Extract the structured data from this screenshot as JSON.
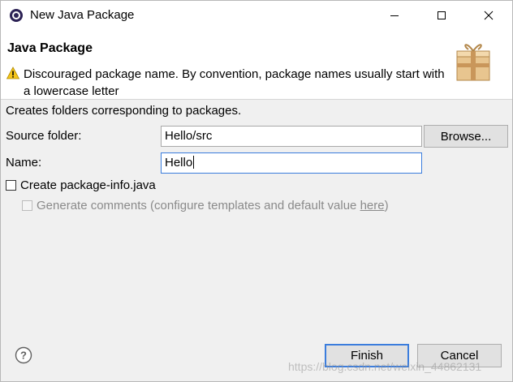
{
  "window": {
    "title": "New Java Package",
    "controls": {
      "minimize_icon": "minimize-icon",
      "maximize_icon": "maximize-icon",
      "close_icon": "close-icon"
    }
  },
  "banner": {
    "title": "Java Package",
    "message": "Discouraged package name. By convention, package names usually start with a lowercase letter",
    "message_icon": "warning-icon",
    "graphic": "package-icon"
  },
  "form": {
    "description": "Creates folders corresponding to packages.",
    "source_folder": {
      "label": "Source folder:",
      "value": "Hello/src",
      "browse_label": "Browse..."
    },
    "name": {
      "label": "Name:",
      "value": "Hello"
    },
    "create_package_info": {
      "label": "Create package-info.java",
      "checked": false
    },
    "generate_comments": {
      "label": "Generate comments (configure templates and default value ",
      "link": "here",
      "suffix": ")",
      "checked": false,
      "enabled": false
    }
  },
  "footer": {
    "help_icon": "help-icon",
    "finish_label": "Finish",
    "cancel_label": "Cancel"
  },
  "watermark": "https://blog.csdn.net/weixin_44862131",
  "colors": {
    "accent": "#3b7ddd",
    "warning": "#f5c518",
    "dialog_bg": "#f0f0f0"
  }
}
